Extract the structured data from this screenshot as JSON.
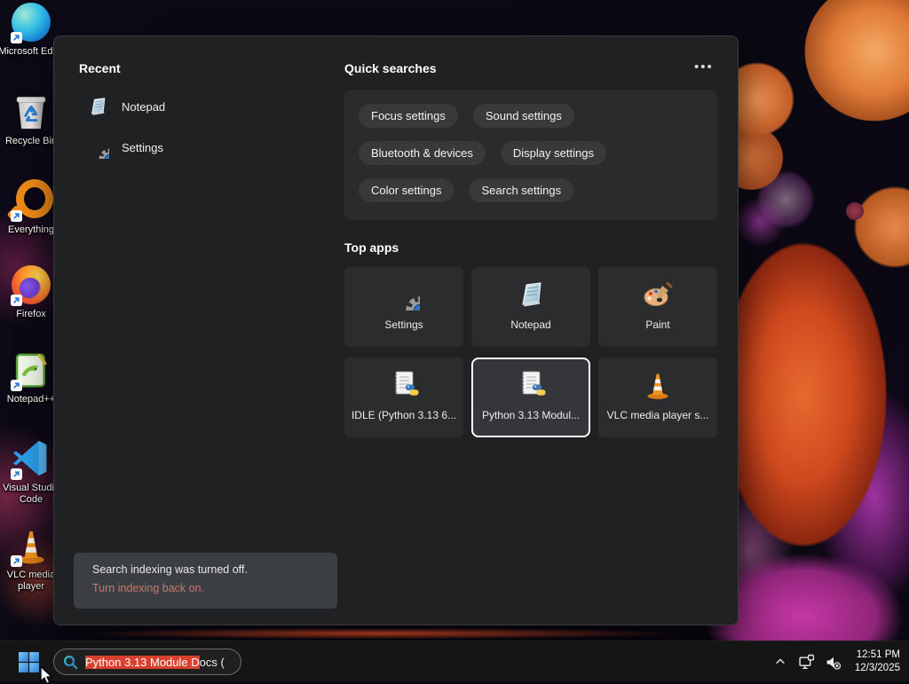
{
  "colors": {
    "panel_bg": "#202123",
    "card_bg": "#2a2b2c",
    "pill_bg": "#39393b",
    "tile_bg": "#2b2c2e",
    "selection_red": "#d7402c",
    "notice_link": "#c9786c",
    "accent_blue": "#4a9fe8",
    "taskbar_bg": "#151515"
  },
  "icons": {
    "start": "windows-logo-icon",
    "search": "search-icon",
    "more": "ellipsis-icon",
    "tray": [
      "chevron-up-icon",
      "network-icon",
      "volume-mute-icon"
    ],
    "cursor": "mouse-cursor"
  },
  "desktop": {
    "icons": [
      {
        "label": "Recycle Bin"
      },
      {
        "label": "Everything"
      },
      {
        "label": "Firefox"
      },
      {
        "label": "Notepad++"
      },
      {
        "label": "Visual Studio Code"
      },
      {
        "label": "VLC media player"
      },
      {
        "label": "Microsoft Edge"
      }
    ]
  },
  "search_panel": {
    "recent": {
      "title": "Recent",
      "items": [
        {
          "label": "Notepad"
        },
        {
          "label": "Settings"
        }
      ]
    },
    "quick_searches": {
      "title": "Quick searches",
      "more_label": "•••",
      "pills": [
        "Focus settings",
        "Sound settings",
        "Bluetooth & devices",
        "Display settings",
        "Color settings",
        "Search settings"
      ]
    },
    "top_apps": {
      "title": "Top apps",
      "tiles": [
        {
          "label": "Settings"
        },
        {
          "label": "Notepad"
        },
        {
          "label": "Paint"
        },
        {
          "label": "IDLE (Python 3.13 6..."
        },
        {
          "label": "Python 3.13 Modul...",
          "selected": true
        },
        {
          "label": "VLC media player s..."
        }
      ]
    },
    "indexing_notice": {
      "message": "Search indexing was turned off.",
      "action": "Turn indexing back on."
    }
  },
  "taskbar": {
    "search": {
      "selected_text": "Python 3.13 Module D",
      "rest_text": "ocs ("
    },
    "clock": {
      "time": "12:51 PM",
      "date": "12/3/2025"
    }
  }
}
